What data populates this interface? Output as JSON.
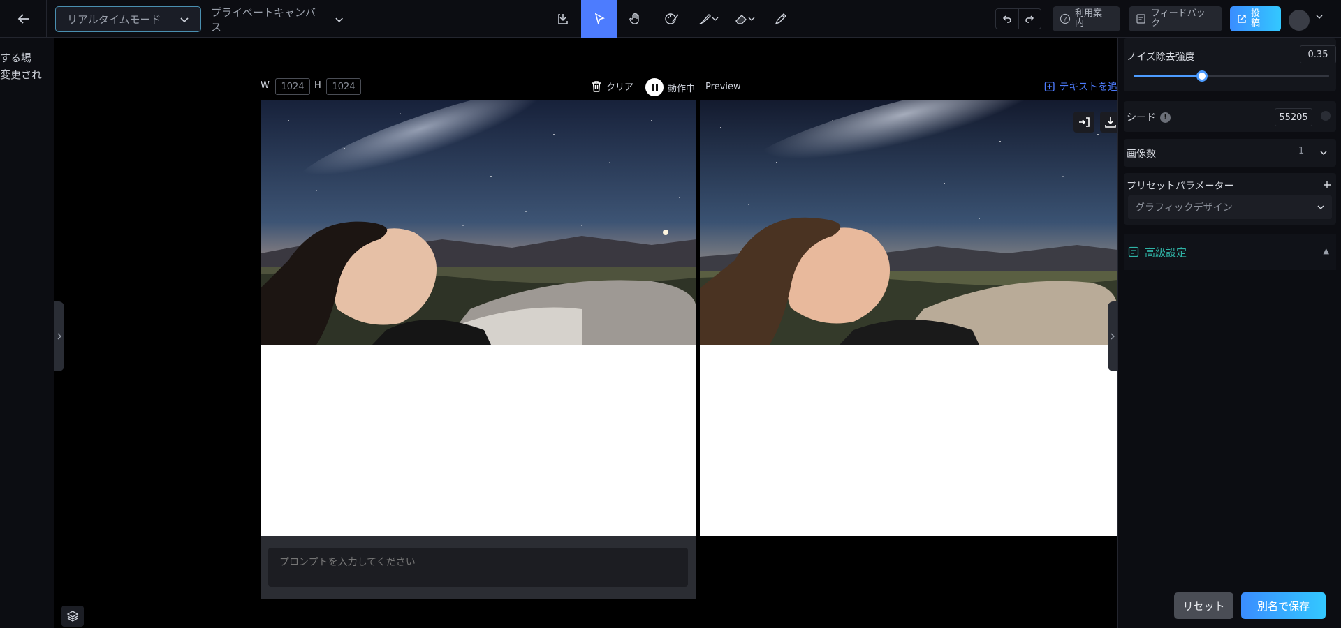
{
  "topbar": {
    "mode_select": "リアルタイムモード",
    "canvas_select": "プライベートキャンバス",
    "guide_label": "利用案内",
    "feedback_label": "フィードバック",
    "post_label": "投稿"
  },
  "left": {
    "line1": "する場",
    "line2": "変更され"
  },
  "canvas": {
    "width_label": "W",
    "width_value": "1024",
    "height_label": "H",
    "height_value": "1024",
    "clear_label": "クリア",
    "running_label": "動作中",
    "preview_label": "Preview",
    "add_text_label": "テキストを追",
    "prompt_placeholder": "プロンプトを入力してください"
  },
  "right_panel": {
    "noise_label": "ノイズ除去強度",
    "noise_value": "0.35",
    "noise_level": 0.35,
    "seed_label": "シード",
    "seed_value": "55205",
    "image_count_label": "画像数",
    "image_count_value": "1",
    "preset_label": "プリセットパラメーター",
    "preset_value": "グラフィックデザイン",
    "advanced_label": "高級設定",
    "reset_label": "リセット",
    "save_as_label": "別名で保存"
  },
  "colors": {
    "accent": "#4d7cfe",
    "cyan_gradient_start": "#3a8dff",
    "cyan_gradient_end": "#33c8ff",
    "advanced_teal": "#2fb3a6"
  }
}
